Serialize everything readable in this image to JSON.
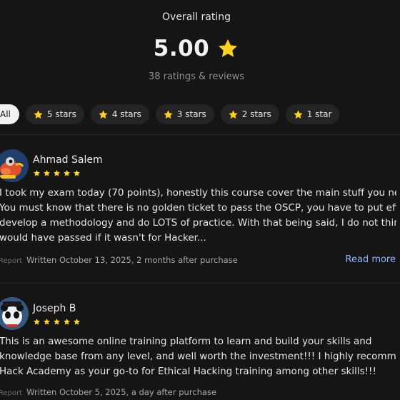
{
  "summary": {
    "label": "Overall rating",
    "score": "5.00",
    "count": "38 ratings & reviews"
  },
  "filters": [
    {
      "label": "All",
      "active": true,
      "icon": "none"
    },
    {
      "label": "5 stars",
      "icon": "star-icon"
    },
    {
      "label": "4 stars",
      "icon": "star-icon"
    },
    {
      "label": "3 stars",
      "icon": "star-icon"
    },
    {
      "label": "2 stars",
      "icon": "star-icon"
    },
    {
      "label": "1 star",
      "icon": "star-icon"
    }
  ],
  "colors": {
    "star": "#ffd21f",
    "link": "#8fb8ff",
    "background": "#151515"
  },
  "reviews": [
    {
      "name": "Ahmad Salem",
      "rating": 5,
      "avatar": "hippo-avatar-icon",
      "text_lines": [
        "I took my exam today (70 points), honestly this course cover the main stuff you need.",
        "You must know that there is no golden ticket to pass the OSCP, you have to put effort,",
        "develop a methodology and do LOTS of practice. With that being said, I do not think I",
        "would have passed if it wasn't for Hacker..."
      ],
      "report": "Report",
      "written": "Written October 13, 2025, 2 months after purchase",
      "read_more": "Read more"
    },
    {
      "name": "Joseph B",
      "rating": 5,
      "avatar": "panda-avatar-icon",
      "text_lines": [
        "This is an awesome online training platform to learn and build your skills and",
        "knowledge base from any level, and well worth the investment!!! I highly recommend",
        "Hack Academy as your go-to for Ethical Hacking training among other skills!!!"
      ],
      "report": "Report",
      "written": "Written October 5, 2025, a day after purchase"
    }
  ]
}
